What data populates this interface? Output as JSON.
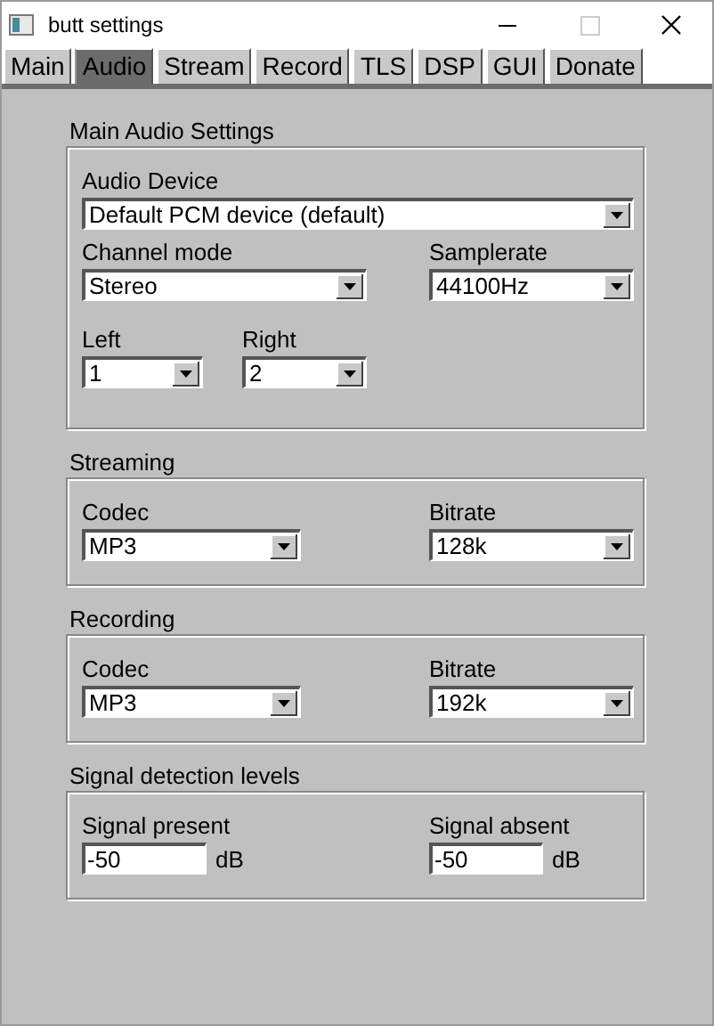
{
  "window": {
    "title": "butt settings"
  },
  "tabs": [
    {
      "label": "Main",
      "selected": false
    },
    {
      "label": "Audio",
      "selected": true
    },
    {
      "label": "Stream",
      "selected": false
    },
    {
      "label": "Record",
      "selected": false
    },
    {
      "label": "TLS",
      "selected": false
    },
    {
      "label": "DSP",
      "selected": false
    },
    {
      "label": "GUI",
      "selected": false
    },
    {
      "label": "Donate",
      "selected": false
    }
  ],
  "sections": [
    {
      "title": "Main Audio Settings",
      "rows": [
        [
          {
            "kind": "dropdown",
            "label": "Audio Device",
            "value": "Default PCM device (default)"
          }
        ],
        [
          {
            "kind": "dropdown",
            "label": "Channel mode",
            "value": "Stereo"
          },
          {
            "kind": "dropdown",
            "label": "Samplerate",
            "value": "44100Hz"
          }
        ],
        [
          {
            "kind": "dropdown",
            "label": "Left",
            "value": "1"
          },
          {
            "kind": "dropdown",
            "label": "Right",
            "value": "2"
          }
        ]
      ]
    },
    {
      "title": "Streaming",
      "rows": [
        [
          {
            "kind": "dropdown",
            "label": "Codec",
            "value": "MP3"
          },
          {
            "kind": "dropdown",
            "label": "Bitrate",
            "value": "128k"
          }
        ]
      ]
    },
    {
      "title": "Recording",
      "rows": [
        [
          {
            "kind": "dropdown",
            "label": "Codec",
            "value": "MP3"
          },
          {
            "kind": "dropdown",
            "label": "Bitrate",
            "value": "192k"
          }
        ]
      ]
    },
    {
      "title": "Signal detection levels",
      "rows": [
        [
          {
            "kind": "input",
            "label": "Signal present",
            "value": "-50",
            "unit": "dB"
          },
          {
            "kind": "input",
            "label": "Signal absent",
            "value": "-50",
            "unit": "dB"
          }
        ]
      ]
    }
  ]
}
